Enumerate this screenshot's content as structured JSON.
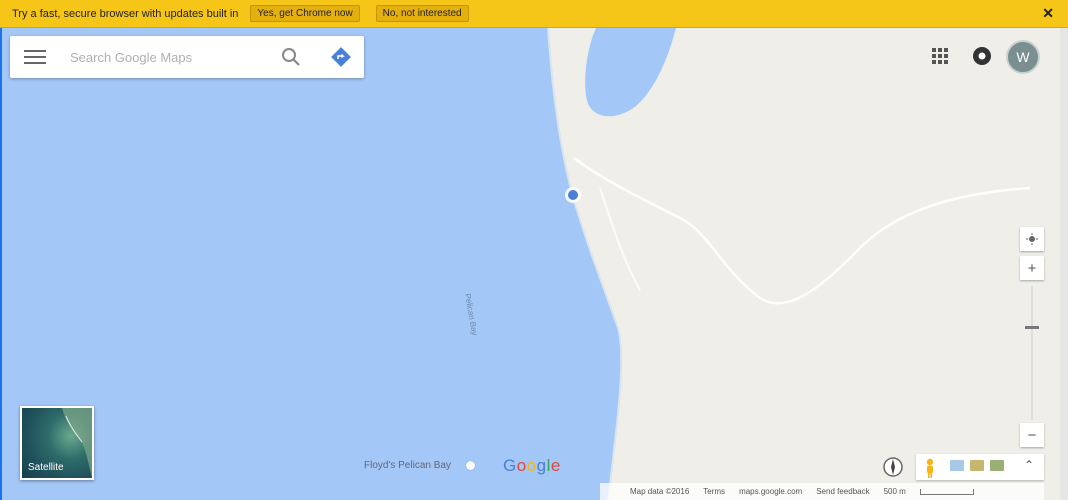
{
  "infobar": {
    "message": "Try a fast, secure browser with updates built in",
    "yes_button": "Yes, get Chrome now",
    "no_button": "No, not interested",
    "close_icon": "close-icon",
    "close_glyph": "✕",
    "background": "#f5c518"
  },
  "search": {
    "placeholder": "Search Google Maps",
    "menu_icon": "hamburger-menu-icon",
    "search_icon": "search-icon",
    "directions_icon": "directions-icon"
  },
  "header": {
    "apps_icon": "apps-grid-icon",
    "notifications_icon": "notifications-icon",
    "avatar_initial": "W"
  },
  "map": {
    "water_color": "#a3c7f7",
    "land_color": "#f0eee8",
    "current_location_icon": "location-dot-icon",
    "road_label": "Pelican Bay",
    "place_label": "Floyd's Pelican Bay",
    "google_logo": "Google"
  },
  "zoom": {
    "my_location_icon": "my-location-icon",
    "zoom_in": "+",
    "zoom_out": "−",
    "zoom_level": 0.7
  },
  "satellite": {
    "label": "Satellite"
  },
  "statusbar": {
    "map_data": "Map data ©2016",
    "terms": "Terms",
    "site": "maps.google.com",
    "feedback": "Send feedback",
    "scale": "500 m"
  },
  "tools": {
    "compass_icon": "compass-icon",
    "pegman_icon": "pegman-icon",
    "expand_icon": "expand-up-icon",
    "expand_glyph": "⌃"
  }
}
